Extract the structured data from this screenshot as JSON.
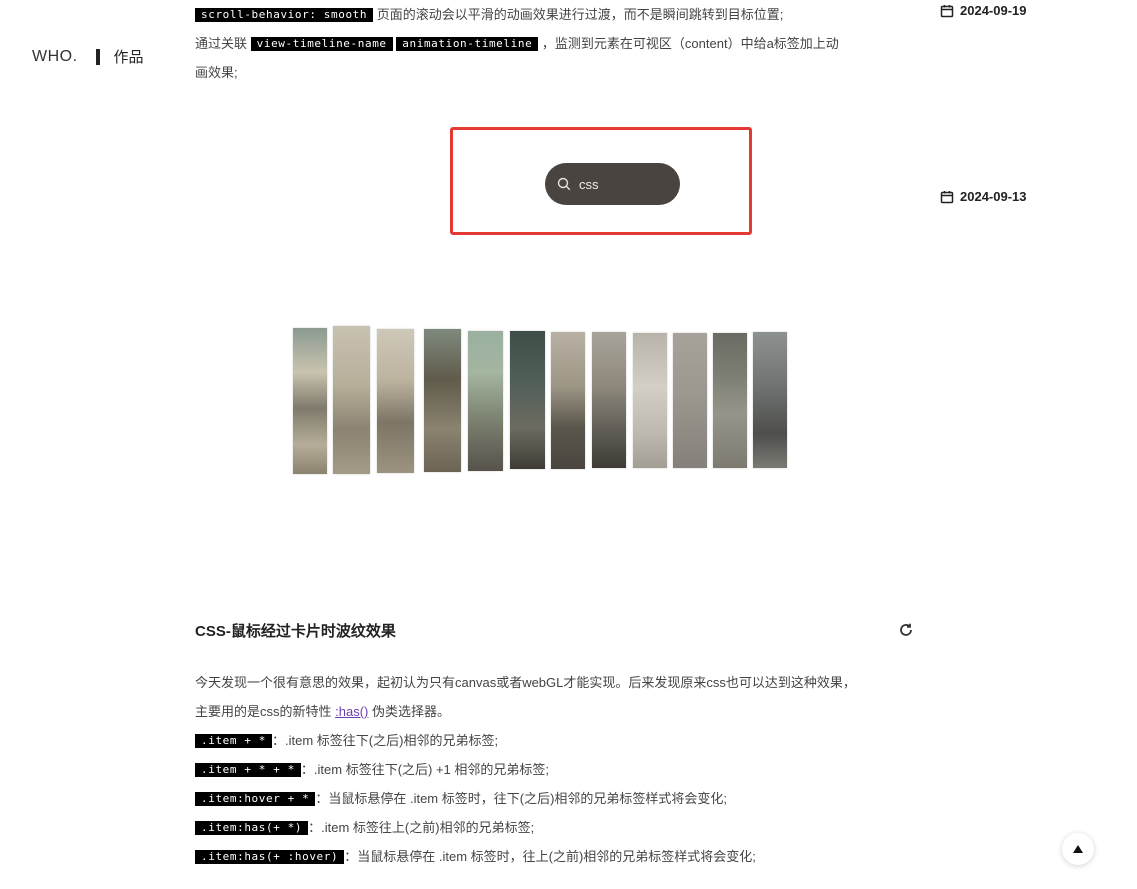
{
  "sidebar": {
    "logo": "WHO.",
    "nav_label": "作品"
  },
  "dates": [
    "2024-09-19",
    "2024-09-13"
  ],
  "post1": {
    "line1_code": "scroll-behavior: smooth",
    "line1_text": "页面的滚动会以平滑的动画效果进行过渡，而不是瞬间跳转到目标位置;",
    "line2_prefix": "通过关联",
    "line2_code1": "view-timeline-name",
    "line2_code2": "animation-timeline",
    "line2_suffix": "，监测到元素在可视区（content）中给a标签加上动",
    "line3_text": "画效果;"
  },
  "search": {
    "value": "css"
  },
  "article": {
    "title": "CSS-鼠标经过卡片时波纹效果",
    "intro1": "今天发现一个很有意思的效果，起初认为只有canvas或者webGL才能实现。后来发现原来css也可以达到这种效果，",
    "intro2_prefix": "主要用的是css的新特性",
    "intro2_link": ":has()",
    "intro2_suffix": "伪类选择器。",
    "rules": [
      {
        "code": ".item + *",
        "text": "：.item 标签往下(之后)相邻的兄弟标签;"
      },
      {
        "code": ".item + * + *",
        "text": "：.item 标签往下(之后) +1 相邻的兄弟标签;"
      },
      {
        "code": ".item:hover + *",
        "text": "：当鼠标悬停在 .item 标签时，往下(之后)相邻的兄弟标签样式将会变化;"
      },
      {
        "code": ".item:has(+ *)",
        "text": "：.item 标签往上(之前)相邻的兄弟标签;"
      },
      {
        "code": ".item:has(+ :hover)",
        "text": "：当鼠标悬停在 .item 标签时，往上(之前)相邻的兄弟标签样式将会变化;"
      }
    ]
  },
  "icons": {
    "calendar": "calendar-icon",
    "search": "search-icon",
    "refresh": "refresh-icon",
    "back_to_top": "arrow-up-icon"
  },
  "colors": {
    "highlight": "#e53935",
    "search_pill": "#4a4440",
    "code_bg": "#000000",
    "link": "#6a3fb0"
  }
}
